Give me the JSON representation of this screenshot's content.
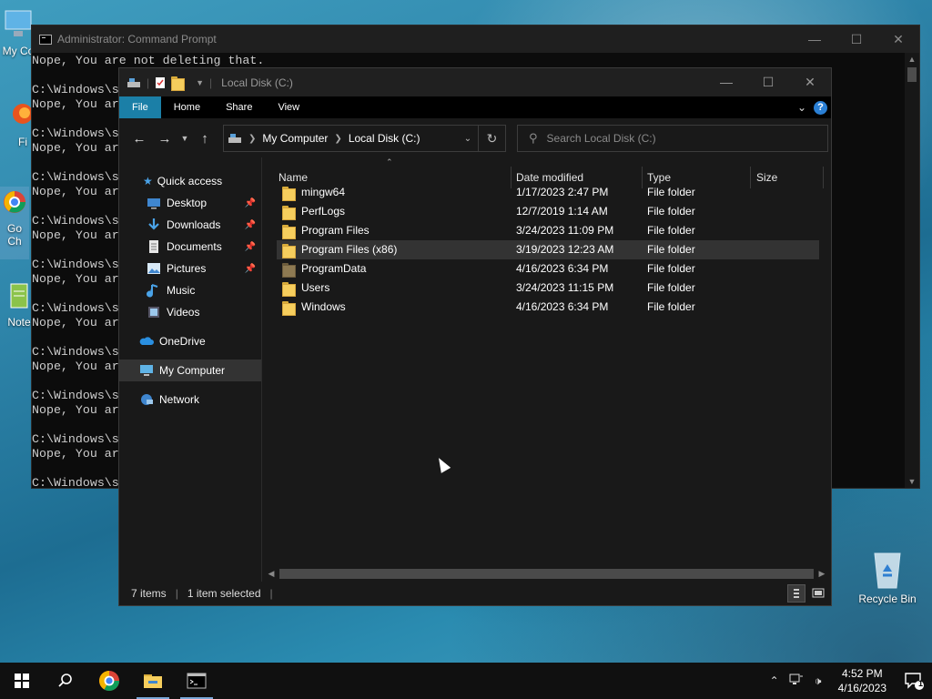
{
  "desktop": {
    "icons": [
      {
        "label": "My Co"
      },
      {
        "label": "Fi"
      },
      {
        "label": "Go Ch"
      },
      {
        "label": "Note"
      },
      {
        "label": "Recycle Bin"
      }
    ]
  },
  "cmd": {
    "title": "Administrator:  Command Prompt",
    "lines": [
      "Nope, You are not deleting that.",
      "",
      "C:\\Windows\\s",
      "Nope, You ar",
      "",
      "C:\\Windows\\s",
      "Nope, You ar",
      "",
      "C:\\Windows\\s",
      "Nope, You ar",
      "",
      "C:\\Windows\\s",
      "Nope, You ar",
      "",
      "C:\\Windows\\s",
      "Nope, You ar",
      "",
      "C:\\Windows\\s",
      "Nope, You ar",
      "",
      "C:\\Windows\\s",
      "Nope, You ar",
      "",
      "C:\\Windows\\s",
      "Nope, You ar",
      "",
      "C:\\Windows\\s",
      "Nope, You ar",
      "",
      "C:\\Windows\\s"
    ]
  },
  "explorer": {
    "title": "Local Disk (C:)",
    "ribbon_tabs": [
      "File",
      "Home",
      "Share",
      "View"
    ],
    "breadcrumb": [
      "My Computer",
      "Local Disk (C:)"
    ],
    "search_placeholder": "Search Local Disk (C:)",
    "nav": {
      "quick_access": "Quick access",
      "items": [
        {
          "label": "Desktop",
          "icon": "desktop-icon",
          "pinned": true
        },
        {
          "label": "Downloads",
          "icon": "downloads-icon",
          "pinned": true
        },
        {
          "label": "Documents",
          "icon": "documents-icon",
          "pinned": true
        },
        {
          "label": "Pictures",
          "icon": "pictures-icon",
          "pinned": true
        },
        {
          "label": "Music",
          "icon": "music-icon",
          "pinned": false
        },
        {
          "label": "Videos",
          "icon": "videos-icon",
          "pinned": false
        }
      ],
      "onedrive": "OneDrive",
      "my_computer": "My Computer",
      "network": "Network"
    },
    "columns": [
      "Name",
      "Date modified",
      "Type",
      "Size"
    ],
    "files": [
      {
        "name": "mingw64",
        "date": "1/17/2023 2:47 PM",
        "type": "File folder",
        "selected": false,
        "dim": false
      },
      {
        "name": "PerfLogs",
        "date": "12/7/2019 1:14 AM",
        "type": "File folder",
        "selected": false,
        "dim": false
      },
      {
        "name": "Program Files",
        "date": "3/24/2023 11:09 PM",
        "type": "File folder",
        "selected": false,
        "dim": false
      },
      {
        "name": "Program Files (x86)",
        "date": "3/19/2023 12:23 AM",
        "type": "File folder",
        "selected": true,
        "dim": false
      },
      {
        "name": "ProgramData",
        "date": "4/16/2023 6:34 PM",
        "type": "File folder",
        "selected": false,
        "dim": true
      },
      {
        "name": "Users",
        "date": "3/24/2023 11:15 PM",
        "type": "File folder",
        "selected": false,
        "dim": false
      },
      {
        "name": "Windows",
        "date": "4/16/2023 6:34 PM",
        "type": "File folder",
        "selected": false,
        "dim": false
      }
    ],
    "status": {
      "items": "7 items",
      "selected": "1 item selected"
    }
  },
  "taskbar": {
    "time": "4:52 PM",
    "date": "4/16/2023",
    "notification_count": "1"
  },
  "colors": {
    "accent": "#1b7fa7",
    "selection": "#333333",
    "folder": "#f6ce5d"
  }
}
